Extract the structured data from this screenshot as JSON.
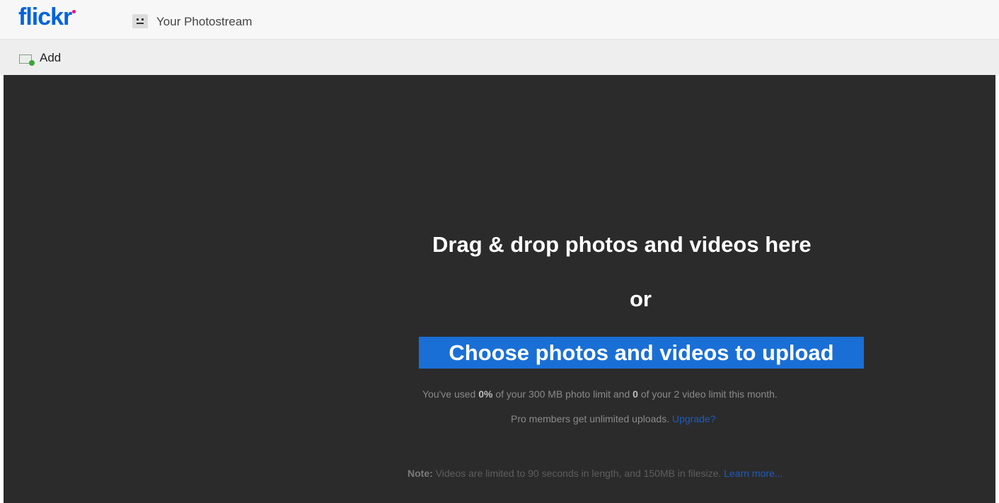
{
  "header": {
    "logo_text_main": "flick",
    "logo_text_r": "r",
    "photostream_label": "Your Photostream"
  },
  "toolbar": {
    "add_label": "Add"
  },
  "upload": {
    "drag_text": "Drag & drop photos and videos here",
    "or_text": "or",
    "choose_label": "Choose photos and videos to upload",
    "usage_prefix": "You've used ",
    "usage_percent": "0%",
    "usage_middle": " of your 300 MB photo limit and ",
    "usage_videos": "0",
    "usage_suffix": " of your 2 video limit this month.",
    "pro_text": "Pro members get unlimited uploads. ",
    "upgrade_link": "Upgrade?",
    "note_label": "Note:",
    "note_text": " Videos are limited to 90 seconds in length, and 150MB in filesize. ",
    "learn_more_link": "Learn more..."
  },
  "colors": {
    "brand_blue": "#0063dc",
    "brand_pink": "#ff0084",
    "stage_bg": "#2b2b2b",
    "button_blue": "#1a6fd6",
    "link_blue": "#1f5bbd"
  },
  "icons": {
    "buddy": "buddy-icon",
    "add": "add-photo-icon"
  }
}
